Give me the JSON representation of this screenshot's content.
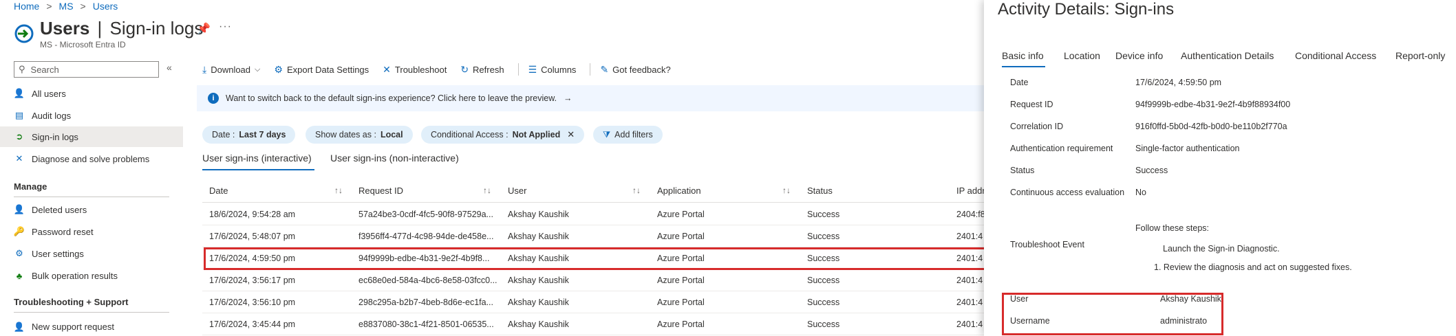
{
  "breadcrumb": [
    "Home",
    "MS",
    "Users"
  ],
  "header": {
    "title": "Users",
    "subtitle_part": "Sign-in logs",
    "org": "MS - Microsoft Entra ID"
  },
  "sidebar": {
    "search_placeholder": "Search",
    "items_top": [
      {
        "label": "All users",
        "icon": "user-icon"
      },
      {
        "label": "Audit logs",
        "icon": "log-icon"
      },
      {
        "label": "Sign-in logs",
        "icon": "sign-in-icon",
        "active": true
      },
      {
        "label": "Diagnose and solve problems",
        "icon": "wrench-icon"
      }
    ],
    "manage_heading": "Manage",
    "items_manage": [
      {
        "label": "Deleted users",
        "icon": "deleted-user-icon"
      },
      {
        "label": "Password reset",
        "icon": "key-icon"
      },
      {
        "label": "User settings",
        "icon": "settings-icon"
      },
      {
        "label": "Bulk operation results",
        "icon": "people-icon"
      }
    ],
    "support_heading": "Troubleshooting + Support",
    "partial_item": "New support request"
  },
  "toolbar": {
    "download": "Download",
    "export": "Export Data Settings",
    "troubleshoot": "Troubleshoot",
    "refresh": "Refresh",
    "columns": "Columns",
    "feedback": "Got feedback?"
  },
  "banner": {
    "text": "Want to switch back to the default sign-ins experience? Click here to leave the preview."
  },
  "filters": {
    "date_label": "Date :",
    "date_value": "Last 7 days",
    "show_dates_label": "Show dates as :",
    "show_dates_value": "Local",
    "ca_label": "Conditional Access :",
    "ca_value": "Not Applied",
    "add_filters": "Add filters"
  },
  "tabs": {
    "interactive": "User sign-ins (interactive)",
    "non_interactive": "User sign-ins (non-interactive)"
  },
  "table": {
    "headers": {
      "date": "Date",
      "request_id": "Request ID",
      "user": "User",
      "application": "Application",
      "status": "Status",
      "ip": "IP addr"
    },
    "rows": [
      {
        "date": "18/6/2024, 9:54:28 am",
        "request_id": "57a24be3-0cdf-4fc5-90f8-97529a...",
        "user": "Akshay Kaushik",
        "application": "Azure Portal",
        "status": "Success",
        "ip": "2404:f8"
      },
      {
        "date": "17/6/2024, 5:48:07 pm",
        "request_id": "f3956ff4-477d-4c98-94de-de458e...",
        "user": "Akshay Kaushik",
        "application": "Azure Portal",
        "status": "Success",
        "ip": "2401:4"
      },
      {
        "date": "17/6/2024, 4:59:50 pm",
        "request_id": "94f9999b-edbe-4b31-9e2f-4b9f8...",
        "user": "Akshay Kaushik",
        "application": "Azure Portal",
        "status": "Success",
        "ip": "2401:4"
      },
      {
        "date": "17/6/2024, 3:56:17 pm",
        "request_id": "ec68e0ed-584a-4bc6-8e58-03fcc0...",
        "user": "Akshay Kaushik",
        "application": "Azure Portal",
        "status": "Success",
        "ip": "2401:4"
      },
      {
        "date": "17/6/2024, 3:56:10 pm",
        "request_id": "298c295a-b2b7-4beb-8d6e-ec1fa...",
        "user": "Akshay Kaushik",
        "application": "Azure Portal",
        "status": "Success",
        "ip": "2401:4"
      },
      {
        "date": "17/6/2024, 3:45:44 pm",
        "request_id": "e8837080-38c1-4f21-8501-06535...",
        "user": "Akshay Kaushik",
        "application": "Azure Portal",
        "status": "Success",
        "ip": "2401:4"
      }
    ]
  },
  "panel": {
    "title": "Activity Details: Sign-ins",
    "tabs": [
      "Basic info",
      "Location",
      "Device info",
      "Authentication Details",
      "Conditional Access",
      "Report-only"
    ],
    "fields": [
      {
        "label": "Date",
        "value": "17/6/2024, 4:59:50 pm"
      },
      {
        "label": "Request ID",
        "value": "94f9999b-edbe-4b31-9e2f-4b9f88934f00"
      },
      {
        "label": "Correlation ID",
        "value": "916f0ffd-5b0d-42fb-b0d0-be110b2f770a"
      },
      {
        "label": "Authentication requirement",
        "value": "Single-factor authentication"
      },
      {
        "label": "Status",
        "value": "Success"
      },
      {
        "label": "Continuous access evaluation",
        "value": "No"
      }
    ],
    "troubleshoot": {
      "label": "Troubleshoot Event",
      "steps_heading": "Follow these steps:",
      "link": "Launch the Sign-in Diagnostic.",
      "step1": "1. Review the diagnosis and act on suggested fixes."
    },
    "user_label": "User",
    "user_value": "Akshay Kaushik",
    "username_label": "Username",
    "username_value": "administrato"
  },
  "colors": {
    "accent": "#0f6cbd",
    "highlight": "#d72b2b"
  }
}
